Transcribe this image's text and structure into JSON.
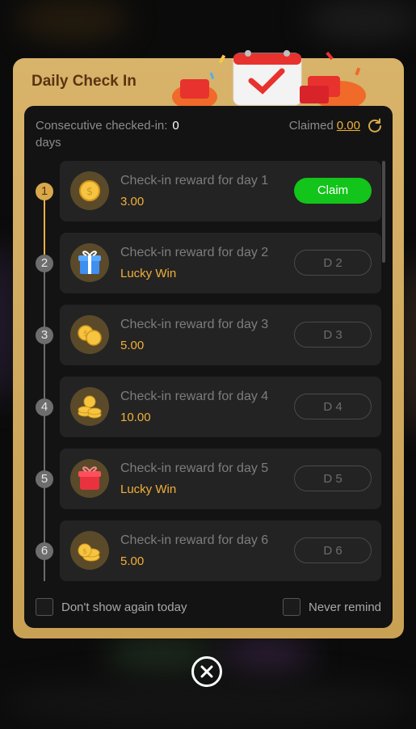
{
  "dialog": {
    "title": "Daily Check In",
    "consecutive_label": "Consecutive checked-in:",
    "consecutive_count": "0",
    "consecutive_unit": "days",
    "claimed_label": "Claimed",
    "claimed_value": "0.00",
    "refresh_icon": "refresh-icon",
    "close_icon": "close-circle-icon"
  },
  "rewards": [
    {
      "step": "1",
      "title": "Check-in reward for day 1",
      "value": "3.00",
      "button": "Claim",
      "icon": "coin-icon",
      "state": "active"
    },
    {
      "step": "2",
      "title": "Check-in reward for day 2",
      "value": "Lucky Win",
      "button": "D 2",
      "icon": "blue-gift-icon",
      "state": "locked"
    },
    {
      "step": "3",
      "title": "Check-in reward for day 3",
      "value": "5.00",
      "button": "D 3",
      "icon": "coins-icon",
      "state": "locked"
    },
    {
      "step": "4",
      "title": "Check-in reward for day 4",
      "value": "10.00",
      "button": "D 4",
      "icon": "coin-stack-icon",
      "state": "locked"
    },
    {
      "step": "5",
      "title": "Check-in reward for day 5",
      "value": "Lucky Win",
      "button": "D 5",
      "icon": "red-gift-icon",
      "state": "locked"
    },
    {
      "step": "6",
      "title": "Check-in reward for day 6",
      "value": "5.00",
      "button": "D 6",
      "icon": "coin-pile-icon",
      "state": "locked"
    }
  ],
  "footer": {
    "dont_show_today": "Don't show again today",
    "never_remind": "Never remind"
  },
  "colors": {
    "accent_gold": "#d9a84a",
    "value_orange": "#f2b03a",
    "claim_green": "#13c41a",
    "title_brown": "#5a3410"
  }
}
